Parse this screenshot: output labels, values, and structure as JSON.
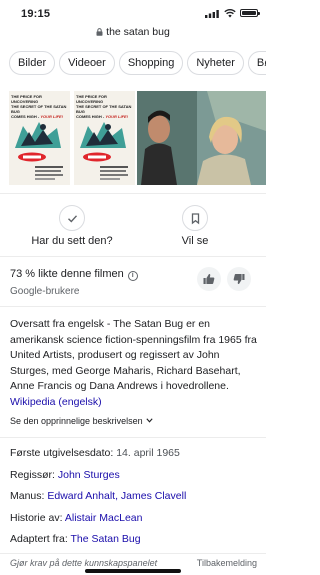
{
  "status": {
    "time": "19:15"
  },
  "url": {
    "text": "the satan bug"
  },
  "chips": [
    "Bilder",
    "Videoer",
    "Shopping",
    "Nyheter",
    "Bø"
  ],
  "poster": {
    "line1": "THE PRICE FOR UNCOVERING",
    "line2": "THE SECRET OF THE SATAN BUG",
    "line3": "COMES HIGH -",
    "line3_accent": "YOUR LIFE!"
  },
  "actions": {
    "seen_label": "Har du sett den?",
    "watchlist_label": "Vil se"
  },
  "rating": {
    "likes_text": "73 % likte denne filmen",
    "info_glyph": "i",
    "source": "Google-brukere"
  },
  "description": {
    "text": "Oversatt fra engelsk - The Satan Bug er en amerikansk science fiction-spenningsfilm fra 1965 fra United Artists, produsert og regissert av John Sturges, med George Maharis, Richard Basehart, Anne Francis og Dana Andrews i hovedrollene.",
    "link": "Wikipedia (engelsk)",
    "show_original": "Se den opprinnelige beskrivelsen"
  },
  "facts": {
    "release_label": "Første utgivelsesdato:",
    "release_value": "14. april 1965",
    "director_label": "Regissør:",
    "director_value": "John Sturges",
    "writers_label": "Manus:",
    "writer1": "Edward Anhalt",
    "writer_sep": ", ",
    "writer2": "James Clavell",
    "story_label": "Historie av:",
    "story_value": "Alistair MacLean",
    "adapted_label": "Adaptert fra:",
    "adapted_value": "The Satan Bug"
  },
  "footer": {
    "left": "Gjør krav på dette kunnskapspanelet",
    "right": "Tilbakemelding"
  },
  "colors": {
    "link": "#1a0dab",
    "text": "#202124",
    "secondary": "#5f6368",
    "chip_border": "#dadce0"
  }
}
